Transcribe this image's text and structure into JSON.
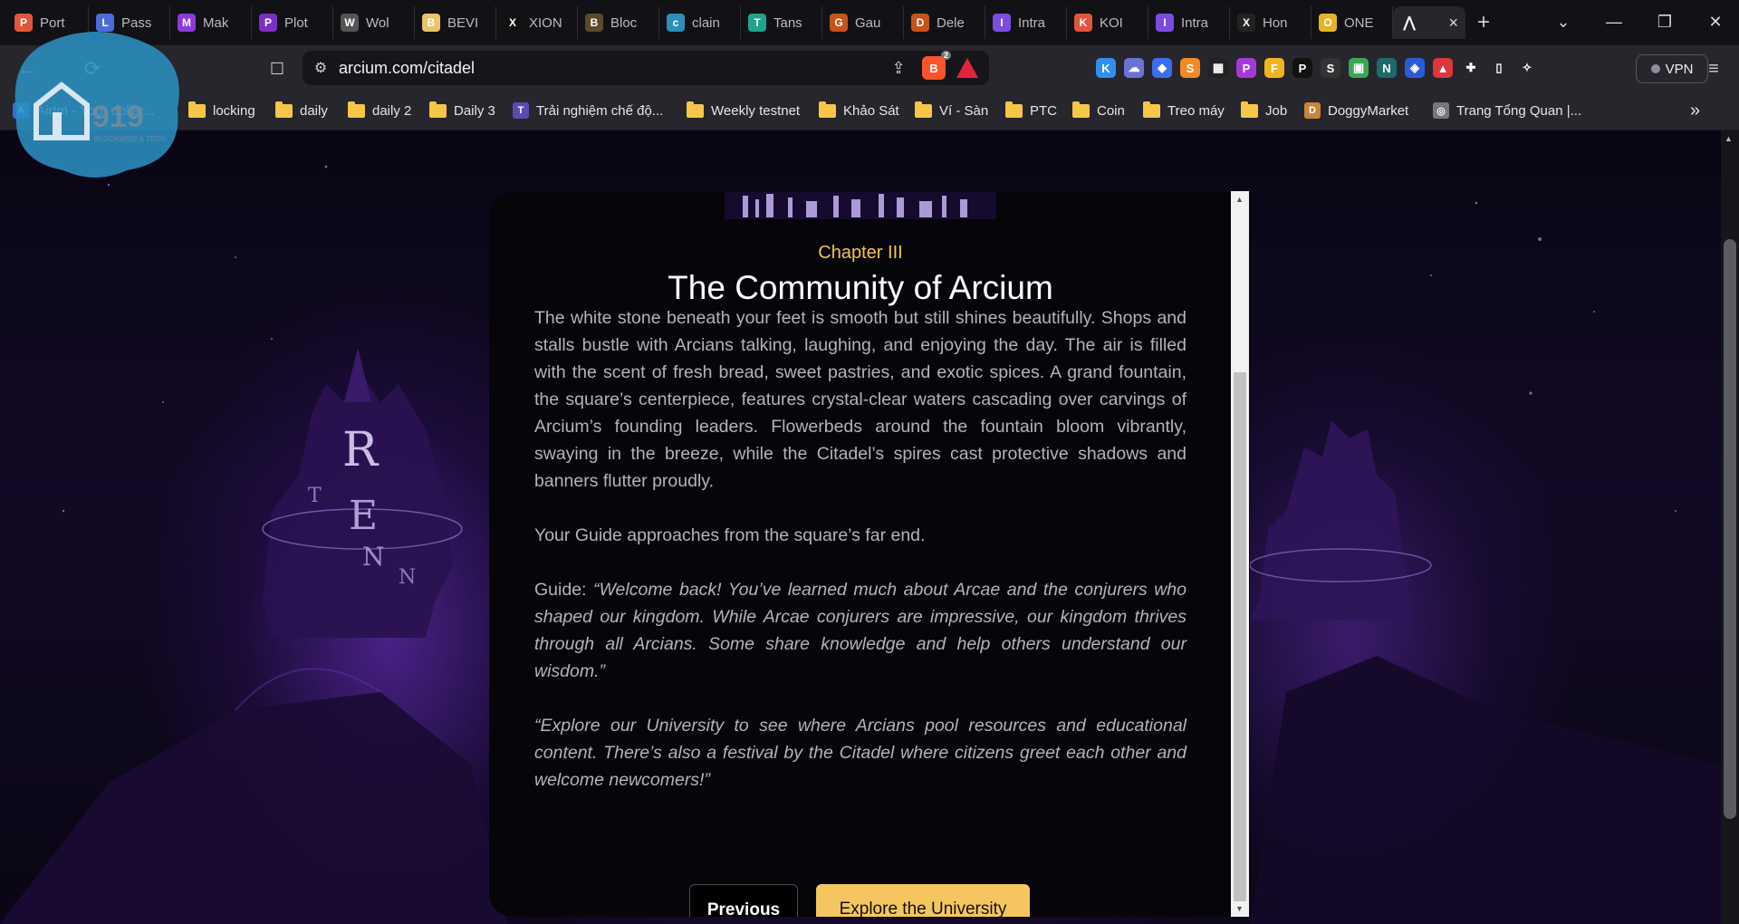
{
  "tabs": [
    {
      "label": "Port",
      "icon": "portfolio-tab-icon",
      "color": "#e2553c",
      "glyph": "P"
    },
    {
      "label": "Pass",
      "icon": "pass-tab-icon",
      "color": "#4a6cd9",
      "glyph": "L"
    },
    {
      "label": "Mak",
      "icon": "make-tab-icon",
      "color": "#8b3bd6",
      "glyph": "M"
    },
    {
      "label": "Plot",
      "icon": "plot-tab-icon",
      "color": "#7a2fc4",
      "glyph": "P"
    },
    {
      "label": "Wol",
      "icon": "wolf-tab-icon",
      "color": "#555",
      "glyph": "W"
    },
    {
      "label": "BEVI",
      "icon": "bevi-tab-icon",
      "color": "#e8c46a",
      "glyph": "B"
    },
    {
      "label": "XION",
      "icon": "xion-tab-icon",
      "color": "#111",
      "glyph": "X"
    },
    {
      "label": "Bloc",
      "icon": "bloc-tab-icon",
      "color": "#5a4a2a",
      "glyph": "B"
    },
    {
      "label": "clain",
      "icon": "claim-tab-icon",
      "color": "#2b8fb7",
      "glyph": "c"
    },
    {
      "label": "Tans",
      "icon": "tans-tab-icon",
      "color": "#1fa38a",
      "glyph": "T"
    },
    {
      "label": "Gau",
      "icon": "gau-tab-icon",
      "color": "#c5541a",
      "glyph": "G"
    },
    {
      "label": "Dele",
      "icon": "dele-tab-icon",
      "color": "#c5541a",
      "glyph": "D"
    },
    {
      "label": "Intra",
      "icon": "intract-tab-icon",
      "color": "#7b4ce0",
      "glyph": "I"
    },
    {
      "label": "KOI",
      "icon": "koi-tab-icon",
      "color": "#e2553c",
      "glyph": "K"
    },
    {
      "label": "Intra",
      "icon": "intract-tab-icon",
      "color": "#7b4ce0",
      "glyph": "I"
    },
    {
      "label": "Hon",
      "icon": "home-tab-icon",
      "color": "#222",
      "glyph": "X"
    },
    {
      "label": "ONE",
      "icon": "one-tab-icon",
      "color": "#e7b425",
      "glyph": "O"
    }
  ],
  "active_tab": {
    "icon": "arcium-tab-icon",
    "close": "×"
  },
  "window": {
    "new_tab": "+",
    "tab_search": "⌄",
    "minimize": "—",
    "restore": "❐",
    "close": "✕"
  },
  "address": {
    "url": "arcium.com/citadel",
    "shield_count": "2"
  },
  "toolbar": {
    "back": "←",
    "reload": "⟳",
    "bookmark": "☐",
    "vpn_label": "VPN"
  },
  "extensions": [
    {
      "name": "k-extension-icon",
      "color": "#2f8ff0",
      "glyph": "K"
    },
    {
      "name": "cloud-extension-icon",
      "color": "#6a72d8",
      "glyph": "☁"
    },
    {
      "name": "diamond-extension-icon",
      "color": "#3a6df0",
      "glyph": "◆"
    },
    {
      "name": "s-extension-icon",
      "color": "#f08a24",
      "glyph": "S"
    },
    {
      "name": "grid-extension-icon",
      "color": "#222",
      "glyph": "▦"
    },
    {
      "name": "p-circle-extension-icon",
      "color": "#a23ad8",
      "glyph": "P"
    },
    {
      "name": "flag-extension-icon",
      "color": "#f2b41c",
      "glyph": "F"
    },
    {
      "name": "p-square-extension-icon",
      "color": "#111",
      "glyph": "P"
    },
    {
      "name": "s-square-extension-icon",
      "color": "#333",
      "glyph": "S"
    },
    {
      "name": "green-square-extension-icon",
      "color": "#3aa655",
      "glyph": "▣"
    },
    {
      "name": "n-extension-icon",
      "color": "#1b6b6b",
      "glyph": "N"
    },
    {
      "name": "shield-extension-icon",
      "color": "#2a5bd7",
      "glyph": "◈"
    },
    {
      "name": "lock-extension-icon",
      "color": "#e0353a",
      "glyph": "▲"
    },
    {
      "name": "puzzle-extension-icon",
      "color": "transparent",
      "glyph": "✚"
    },
    {
      "name": "sidebar-toggle-icon",
      "color": "transparent",
      "glyph": "▯"
    },
    {
      "name": "leo-ai-icon",
      "color": "transparent",
      "glyph": "✧"
    }
  ],
  "bookmarks": [
    {
      "label": "Airtm - Your dollar...",
      "type": "site",
      "color": "#2d6ed8",
      "glyph": "A"
    },
    {
      "label": "locking",
      "type": "folder"
    },
    {
      "label": "daily",
      "type": "folder"
    },
    {
      "label": "daily 2",
      "type": "folder"
    },
    {
      "label": "Daily 3",
      "type": "folder"
    },
    {
      "label": "Trải nghiệm chế độ...",
      "type": "site",
      "color": "#5b4ab6",
      "glyph": "T"
    },
    {
      "label": "Weekly testnet",
      "type": "folder"
    },
    {
      "label": "Khảo Sát",
      "type": "folder"
    },
    {
      "label": "Ví - Sàn",
      "type": "folder"
    },
    {
      "label": "PTC",
      "type": "folder"
    },
    {
      "label": "Coin",
      "type": "folder"
    },
    {
      "label": "Treo máy",
      "type": "folder"
    },
    {
      "label": "Job",
      "type": "folder"
    },
    {
      "label": "DoggyMarket",
      "type": "site",
      "color": "#c8843a",
      "glyph": "D"
    },
    {
      "label": "Trang Tổng Quan |...",
      "type": "site",
      "color": "#777",
      "glyph": "◎"
    }
  ],
  "bookmarks_more": "»",
  "watermark": {
    "text": "919",
    "sub": "BLOCKWISE & TECH"
  },
  "page": {
    "chapter": "Chapter III",
    "title": "The Community of Arcium",
    "paragraphs": [
      {
        "text": "The white stone beneath your feet is smooth but still shines beautifully. Shops and stalls bustle with Arcians talking, laughing, and enjoying the day. The air is filled with the scent of fresh bread, sweet pastries, and exotic spices. A grand fountain, the square’s centerpiece, features crystal-clear waters cascading over carvings of Arcium’s founding leaders. Flowerbeds around the fountain bloom vibrantly, swaying in the breeze, while the Citadel’s spires cast protective shadows and banners flutter proudly.",
        "italic": false
      },
      {
        "text": "Your Guide approaches from the square’s far end.",
        "italic": false
      },
      {
        "prefix": "Guide: ",
        "text": "“Welcome back! You’ve learned much about Arcae and the conjurers who shaped our kingdom. While Arcae conjurers are impressive, our kingdom thrives through all Arcians. Some share knowledge and help others understand our wisdom.”",
        "italic": true
      },
      {
        "text": "“Explore our University to see where Arcians pool resources and educational content. There’s also a festival by the Citadel where citizens greet each other and welcome newcomers!”",
        "italic": true
      }
    ],
    "prev_button": "Previous",
    "next_button": "Explore the University"
  },
  "colors": {
    "accent": "#f5c65f",
    "chapter": "#f5c44e",
    "purple_glow": "#7837dc"
  }
}
